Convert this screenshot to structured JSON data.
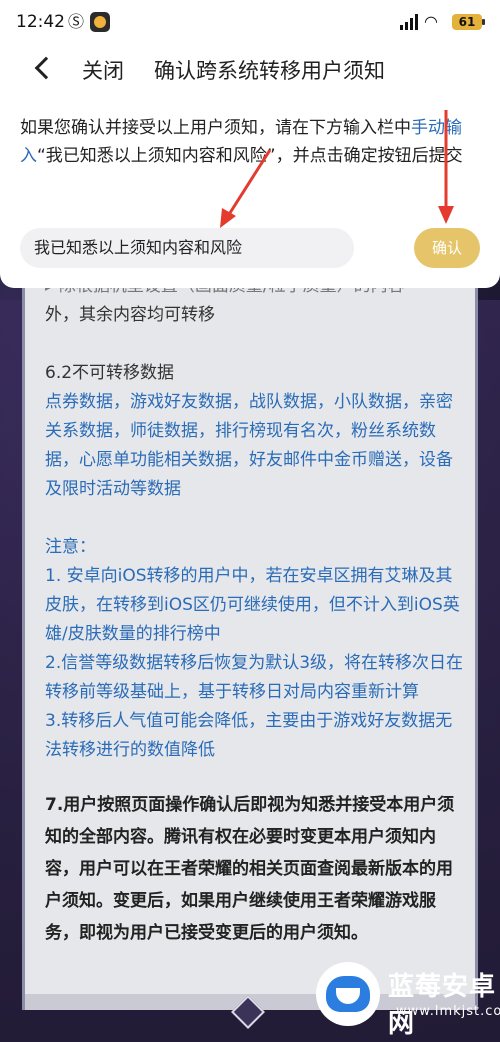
{
  "status_bar": {
    "time": "12:42",
    "battery": "61"
  },
  "nav": {
    "close_label": "关闭",
    "title": "确认跨系统转移用户须知"
  },
  "instruction": {
    "part1": "如果您确认并接受以上用户须知，请在下方输入栏中",
    "link": "手动输入",
    "part2": "“我已知悉以上须知内容和风险”，并点击确定按钮后提交"
  },
  "input": {
    "value": "我已知悉以上须知内容和风险"
  },
  "confirm_label": "确认",
  "notice": {
    "cutoff_line": "▸ 除根据机型设置（画面质量/粒子质量）的内容",
    "line_after": "外，其余内容均可转移",
    "section_title": "6.2不可转移数据",
    "section_body": "点券数据，游戏好友数据，战队数据，小队数据，亲密关系数据，师徒数据，排行榜现有名次，粉丝系统数据，心愿单功能相关数据，好友邮件中金币赠送，设备及限时活动等数据",
    "note_title": "注意：",
    "note1": "1. 安卓向iOS转移的用户中，若在安卓区拥有艾琳及其皮肤，在转移到iOS区仍可继续使用，但不计入到iOS英雄/皮肤数量的排行榜中",
    "note2": "2.信誉等级数据转移后恢复为默认3级，将在转移次日在转移前等级基础上，基于转移日对局内容重新计算",
    "note3": "3.转移后人气值可能会降低，主要由于游戏好友数据无法转移进行的数值降低",
    "clause7": "7.用户按照页面操作确认后即视为知悉并接受本用户须知的全部内容。腾讯有权在必要时变更本用户须知内容，用户可以在王者荣耀的相关页面查阅最新版本的用户须知。变更后，如果用户继续使用王者荣耀游戏服务，即视为用户已接受变更后的用户须知。"
  },
  "watermark": {
    "name": "蓝莓安卓网",
    "url": "www.lmkjst.com"
  },
  "colors": {
    "link_blue": "#2a6cb8",
    "confirm_gold": "#e6c56a",
    "arrow_red": "#e33b2e"
  }
}
